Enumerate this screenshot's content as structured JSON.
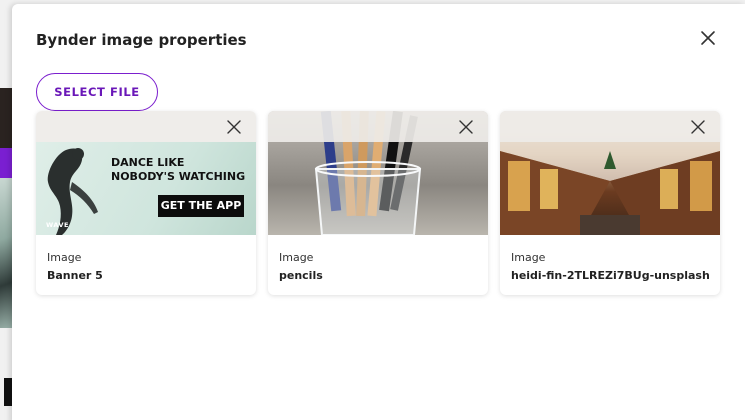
{
  "modal": {
    "title": "Bynder image properties",
    "select_file_label": "SELECT FILE"
  },
  "cards": [
    {
      "type": "Image",
      "name": "Banner 5"
    },
    {
      "type": "Image",
      "name": "pencils"
    },
    {
      "type": "Image",
      "name": "heidi-fin-2TLREZi7BUg-unsplash"
    }
  ],
  "banner": {
    "headline": "DANCE LIKE\nNOBODY'S WATCHING",
    "cta": "GET THE APP",
    "brand": "WAVE"
  },
  "icons": {
    "close": "close-icon",
    "remove": "close-icon"
  },
  "colors": {
    "accent": "#7b1fce",
    "background_app_purple": "#7a1fd1"
  }
}
